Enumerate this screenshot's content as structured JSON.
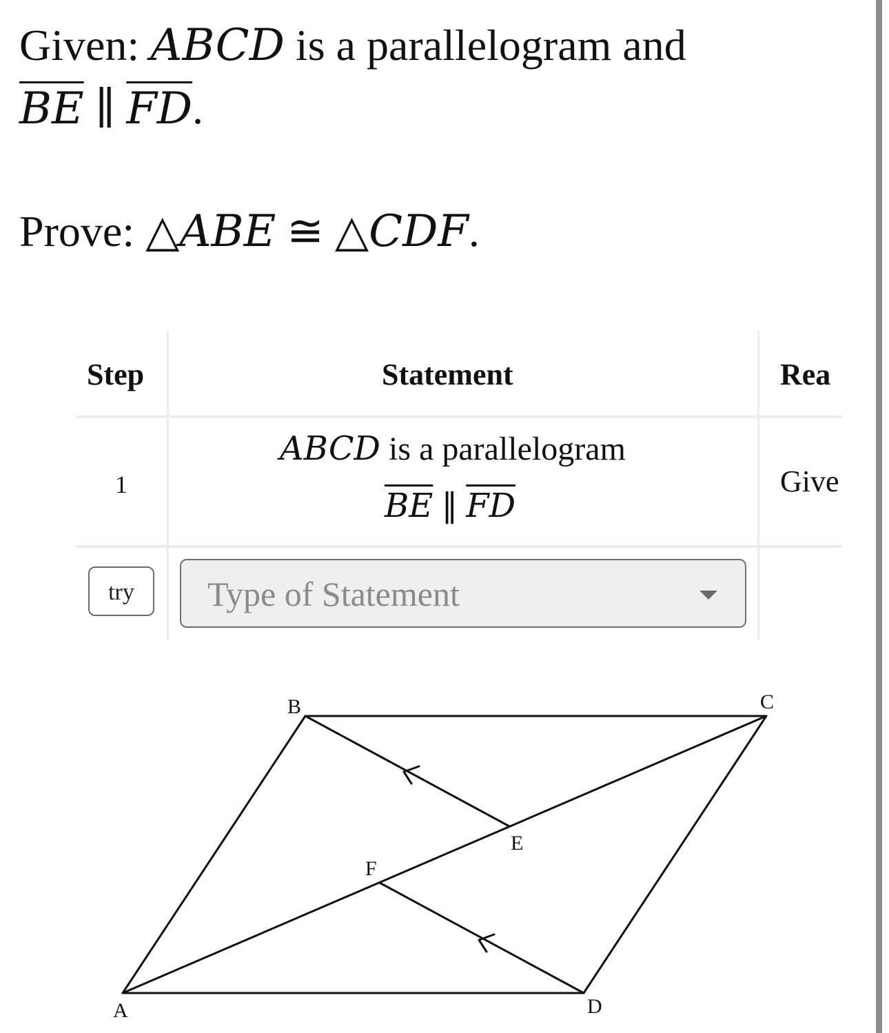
{
  "given": {
    "label": "Given:",
    "shape": "ABCD",
    "text": "is a parallelogram and",
    "seg1": "BE",
    "parallel": "∥",
    "seg2": "FD",
    "end": "."
  },
  "prove": {
    "label": "Prove:",
    "tri_symbol": "△",
    "tri1": "ABE",
    "congruent": "≅",
    "tri2": "CDF",
    "end": "."
  },
  "table": {
    "headers": {
      "step": "Step",
      "statement": "Statement",
      "reason": "Rea"
    },
    "rows": [
      {
        "step": "1",
        "statement_line1_math": "ABCD",
        "statement_line1_text": "is a parallelogram",
        "statement_line2_seg1": "BE",
        "statement_line2_parallel": "∥",
        "statement_line2_seg2": "FD",
        "reason": "Give"
      }
    ],
    "try_button": "try",
    "statement_select": {
      "placeholder": "Type of Statement"
    }
  },
  "diagram": {
    "labels": {
      "A": "A",
      "B": "B",
      "C": "C",
      "D": "D",
      "E": "E",
      "F": "F"
    }
  }
}
